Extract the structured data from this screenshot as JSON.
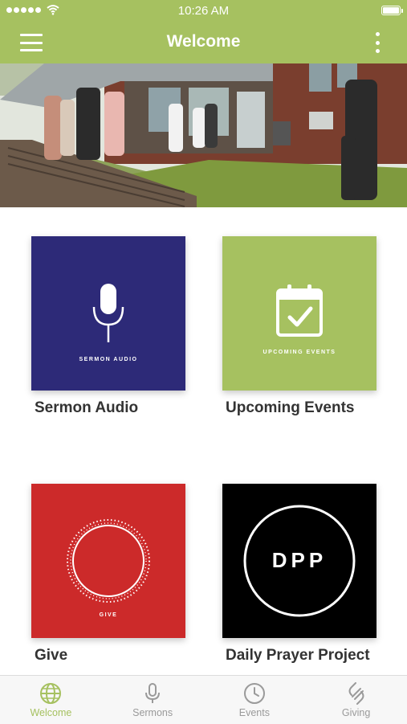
{
  "status_bar": {
    "time": "10:26 AM"
  },
  "nav": {
    "title": "Welcome"
  },
  "tiles": [
    {
      "label": "Sermon Audio",
      "caption": "SERMON AUDIO",
      "color": "#2d2a78",
      "icon": "microphone-icon"
    },
    {
      "label": "Upcoming Events",
      "caption": "UPCOMING EVENTS",
      "color": "#a6c160",
      "icon": "calendar-check-icon"
    },
    {
      "label": "Give",
      "caption": "GIVE",
      "color": "#cc2a2a",
      "icon": "circle-ring-icon"
    },
    {
      "label": "Daily Prayer Project",
      "caption": "DPP",
      "color": "#000000",
      "icon": "dpp-ring-icon"
    }
  ],
  "tabs": [
    {
      "label": "Welcome",
      "icon": "globe-icon",
      "active": true
    },
    {
      "label": "Sermons",
      "icon": "microphone-icon",
      "active": false
    },
    {
      "label": "Events",
      "icon": "clock-icon",
      "active": false
    },
    {
      "label": "Giving",
      "icon": "giving-icon",
      "active": false
    }
  ],
  "colors": {
    "accent": "#a6c160",
    "tab_inactive": "#9a9a9a"
  }
}
